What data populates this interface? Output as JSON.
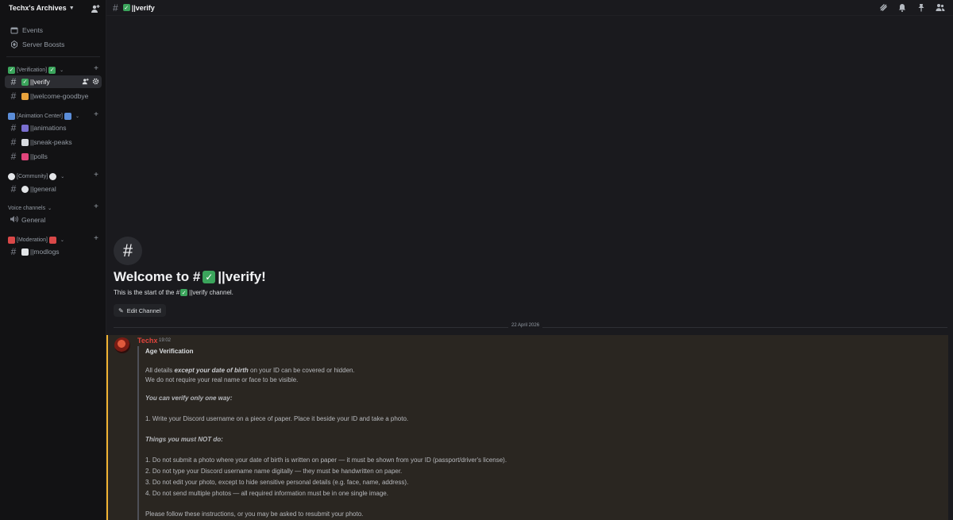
{
  "server": {
    "name": "Techx's Archives"
  },
  "sidebar": {
    "top_items": [
      {
        "label": "Events",
        "icon": "calendar-icon"
      },
      {
        "label": "Server Boosts",
        "icon": "boost-icon"
      }
    ],
    "categories": [
      {
        "label": "[Verification]",
        "channels": [
          {
            "name": "||verify"
          },
          {
            "name": "||welcome-goodbye"
          }
        ]
      },
      {
        "label": "[Animation Center]",
        "channels": [
          {
            "name": "||animations"
          },
          {
            "name": "||sneak-peaks"
          },
          {
            "name": "||polls"
          }
        ]
      },
      {
        "label": "[Community]",
        "channels": [
          {
            "name": "||general"
          }
        ]
      },
      {
        "label": "Voice channels",
        "channels": [
          {
            "name": "General"
          }
        ]
      },
      {
        "label": "[Moderation]",
        "channels": [
          {
            "name": "||modlogs"
          }
        ]
      }
    ]
  },
  "topbar": {
    "channel_name": "||verify"
  },
  "welcome": {
    "hash": "#",
    "title_prefix": "Welcome to #",
    "title_suffix": "||verify!",
    "sub_prefix": "This is the start of the #",
    "sub_suffix": "||verify channel.",
    "edit_label": "Edit Channel"
  },
  "date_divider": "22 April 2026",
  "message": {
    "author": "Techx",
    "time": "19:02",
    "heading": "Age Verification",
    "line1_pre": "All details ",
    "line1_em": "except your date of birth",
    "line1_post": " on your ID can be covered or hidden.",
    "line2": "We do not require your real name or face to be visible.",
    "verify_heading": "You can verify only one way:",
    "step1": "1. Write your Discord username on a piece of paper. Place it beside your ID and take a photo.",
    "not_heading": "Things you must NOT do:",
    "not1": "1. Do not submit a photo where your date of birth is written on paper — it must be shown from your ID (passport/driver's license).",
    "not2": "2. Do not type your Discord username name digitally — they must be handwritten on paper.",
    "not3": "3. Do not edit your photo, except to hide sensitive personal details (e.g. face, name, address).",
    "not4": "4. Do not send multiple photos — all required information must be in one single image.",
    "footer": "Please follow these instructions, or you may be asked to resubmit your photo."
  },
  "colors": {
    "accent": "#f0b232",
    "author": "#e0443c",
    "check": "#3ba55c"
  }
}
